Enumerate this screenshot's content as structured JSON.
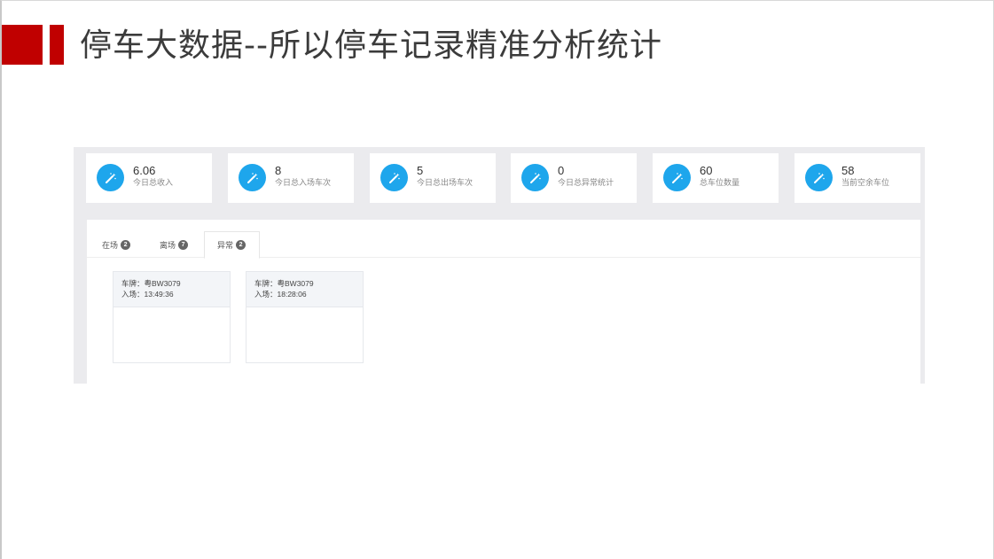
{
  "slide": {
    "title": "停车大数据--所以停车记录精准分析统计",
    "accent_color": "#c00000"
  },
  "stats": [
    {
      "value": "6.06",
      "label": "今日总收入",
      "icon": "wand-icon"
    },
    {
      "value": "8",
      "label": "今日总入场车次",
      "icon": "wand-icon"
    },
    {
      "value": "5",
      "label": "今日总出场车次",
      "icon": "wand-icon"
    },
    {
      "value": "0",
      "label": "今日总异常统计",
      "icon": "wand-icon"
    },
    {
      "value": "60",
      "label": "总车位数量",
      "icon": "wand-icon"
    },
    {
      "value": "58",
      "label": "当前空余车位",
      "icon": "wand-icon"
    }
  ],
  "icon_color": "#1ea6ec",
  "tabs": [
    {
      "label": "在场",
      "count": "2",
      "active": false
    },
    {
      "label": "离场",
      "count": "7",
      "active": false
    },
    {
      "label": "异常",
      "count": "2",
      "active": true
    }
  ],
  "records": [
    {
      "plate_label": "车牌：",
      "plate": "粤BW3079",
      "entry_label": "入场：",
      "entry_time": "13:49:36"
    },
    {
      "plate_label": "车牌：",
      "plate": "粤BW3079",
      "entry_label": "入场：",
      "entry_time": "18:28:06"
    }
  ]
}
